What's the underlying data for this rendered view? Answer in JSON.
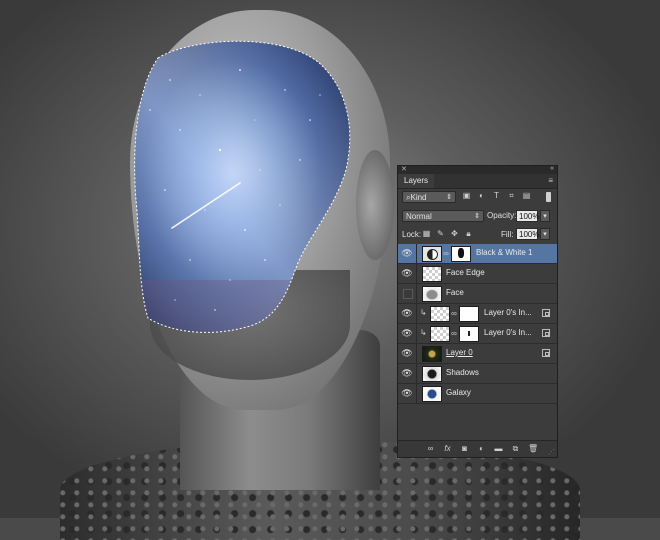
{
  "panel": {
    "title": "Layers",
    "filter_kind": "Kind",
    "blend_mode": "Normal",
    "opacity_label": "Opacity:",
    "opacity_value": "100%",
    "lock_label": "Lock:",
    "fill_label": "Fill:",
    "fill_value": "100%"
  },
  "layers": [
    {
      "name": "Black & White 1",
      "visible": true,
      "selected": true
    },
    {
      "name": "Face Edge",
      "visible": true
    },
    {
      "name": "Face",
      "visible": false
    },
    {
      "name": "Layer 0's In...",
      "visible": true
    },
    {
      "name": "Layer 0's In...",
      "visible": true
    },
    {
      "name": "Layer 0",
      "visible": true
    },
    {
      "name": "Shadows",
      "visible": true
    },
    {
      "name": "Galaxy",
      "visible": true
    }
  ],
  "icons": {
    "filter": [
      "pixel-layer-filter-icon",
      "adjustment-filter-icon",
      "type-filter-icon",
      "shape-filter-icon",
      "smart-object-filter-icon"
    ],
    "lock": [
      "lock-transparent-icon",
      "lock-image-icon",
      "lock-position-icon",
      "lock-all-icon"
    ],
    "bottom": [
      "link-layers-icon",
      "layer-style-icon",
      "add-mask-icon",
      "new-adjustment-icon",
      "new-group-icon",
      "new-layer-icon",
      "delete-layer-icon"
    ]
  },
  "colors": {
    "panel_bg": "#3c3c3c",
    "selected_row": "#5576a2",
    "galaxy_deep": "#0d1d4a",
    "galaxy_light": "#8fb0e0"
  }
}
